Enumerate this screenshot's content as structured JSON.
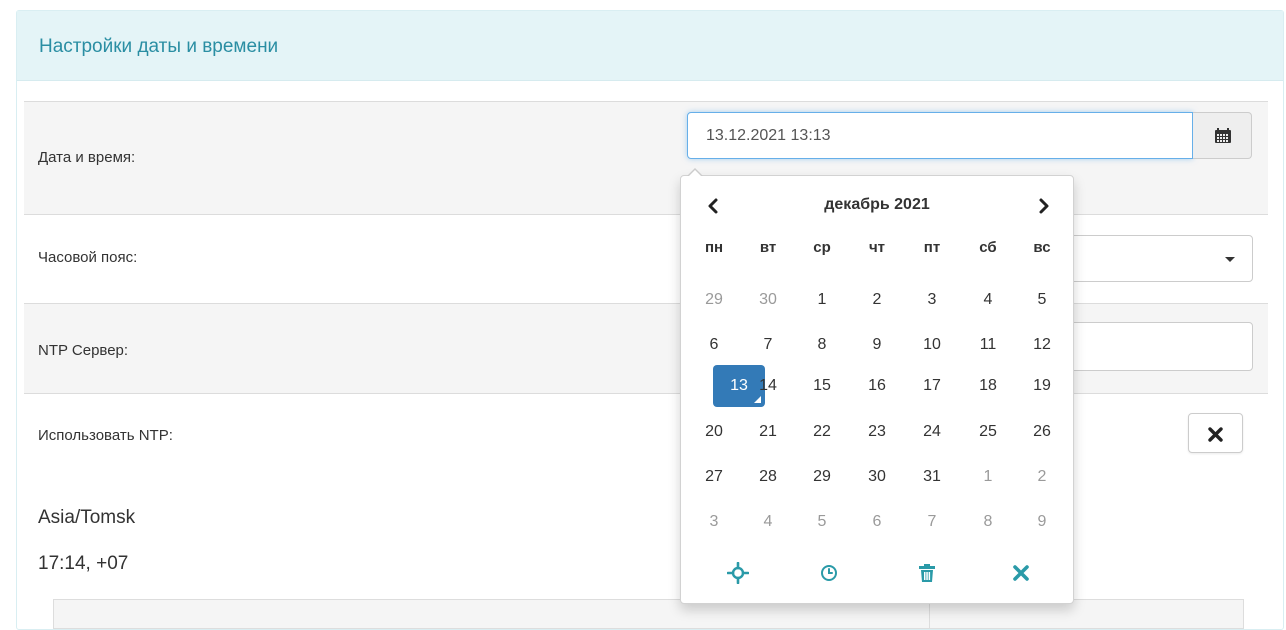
{
  "panel": {
    "title": "Настройки даты и времени"
  },
  "rows": {
    "datetime": {
      "label": "Дата и время:",
      "value": "13.12.2021 13:13"
    },
    "timezone": {
      "label": "Часовой пояс:"
    },
    "ntp_server": {
      "label": "NTP Сервер:"
    },
    "use_ntp": {
      "label": "Использовать NTP:"
    }
  },
  "timezone_info": {
    "name": "Asia/Tomsk",
    "time": "17:14, +07"
  },
  "datepicker": {
    "title": "декабрь 2021",
    "weekdays": [
      "пн",
      "вт",
      "ср",
      "чт",
      "пт",
      "сб",
      "вс"
    ],
    "weeks": [
      [
        "29",
        "30",
        "1",
        "2",
        "3",
        "4",
        "5"
      ],
      [
        "6",
        "7",
        "8",
        "9",
        "10",
        "11",
        "12"
      ],
      [
        "13",
        "14",
        "15",
        "16",
        "17",
        "18",
        "19"
      ],
      [
        "20",
        "21",
        "22",
        "23",
        "24",
        "25",
        "26"
      ],
      [
        "27",
        "28",
        "29",
        "30",
        "31",
        "1",
        "2"
      ],
      [
        "3",
        "4",
        "5",
        "6",
        "7",
        "8",
        "9"
      ]
    ],
    "muted": [
      [
        0,
        0
      ],
      [
        0,
        1
      ],
      [
        4,
        5
      ],
      [
        4,
        6
      ],
      [
        5,
        0
      ],
      [
        5,
        1
      ],
      [
        5,
        2
      ],
      [
        5,
        3
      ],
      [
        5,
        4
      ],
      [
        5,
        5
      ],
      [
        5,
        6
      ]
    ],
    "selected": [
      2,
      0
    ],
    "toolbar": [
      "today-icon",
      "clock-icon",
      "trash-icon",
      "close-icon"
    ]
  },
  "colors": {
    "accent": "#2a8ea3",
    "heading_bg": "#e4f4f7",
    "selected_day": "#337ab7",
    "focus_border": "#66afe9"
  }
}
